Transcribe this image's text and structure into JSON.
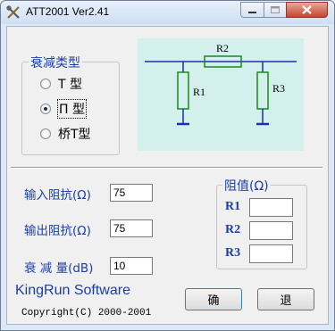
{
  "window": {
    "title": "ATT2001 Ver2.41"
  },
  "type_group": {
    "title": "衰减类型",
    "options": [
      {
        "label": "T 型",
        "checked": false
      },
      {
        "label": "П 型",
        "checked": true
      },
      {
        "label": "桥T型",
        "checked": false
      }
    ]
  },
  "diagram": {
    "r1": "R1",
    "r2": "R2",
    "r3": "R3"
  },
  "inputs": {
    "input_impedance_label": "输入阻抗(Ω)",
    "input_impedance_value": "75",
    "output_impedance_label": "输出阻抗(Ω)",
    "output_impedance_value": "75",
    "attenuation_label": "衰 减 量(dB)",
    "attenuation_value": "10"
  },
  "resistance_group": {
    "title": "阻值(Ω)",
    "r1_label": "R1",
    "r1_value": "",
    "r2_label": "R2",
    "r2_value": "",
    "r3_label": "R3",
    "r3_value": ""
  },
  "footer": {
    "brand": "KingRun Software",
    "copyright": "Copyright(C) 2000-2001"
  },
  "buttons": {
    "ok": "确",
    "cancel": "退"
  },
  "colors": {
    "label_blue": "#1a3ea8",
    "diagram_bg": "#d4f0ec",
    "circuit_blue": "#1a2fb0",
    "circuit_green": "#188a1e"
  }
}
